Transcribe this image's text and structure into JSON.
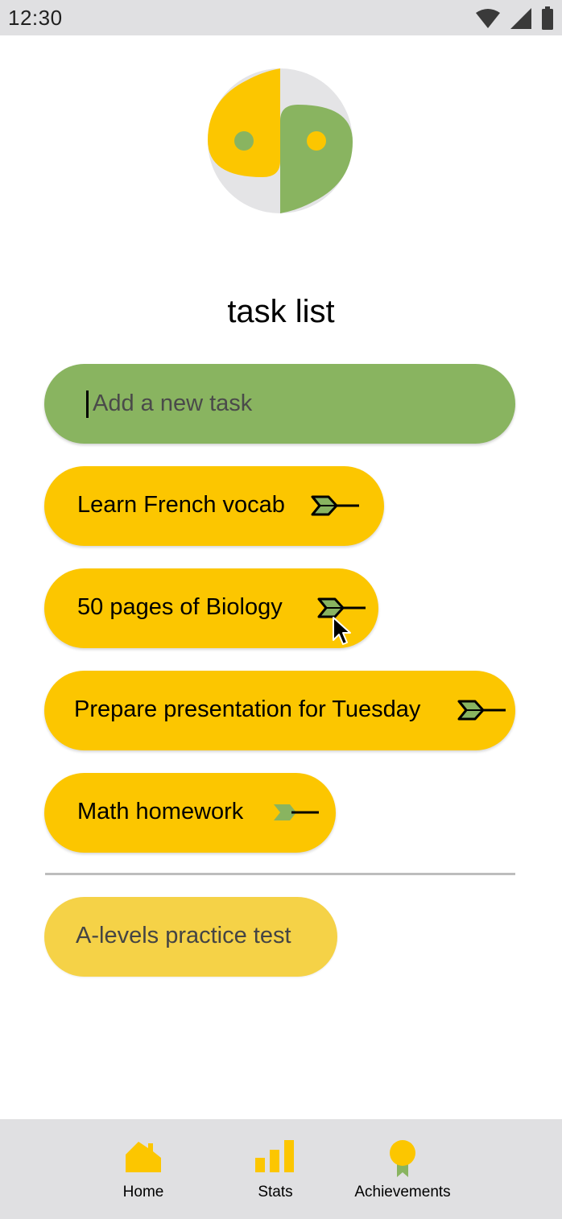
{
  "status_bar": {
    "time": "12:30",
    "icons": [
      "wifi-icon",
      "cellular-signal-icon",
      "battery-icon"
    ]
  },
  "logo": {
    "name": "app-logo",
    "colors": {
      "yellow": "#fcc600",
      "green": "#89b460",
      "gray": "#e4e4e6"
    }
  },
  "title": "task list",
  "new_task_input": {
    "placeholder": "Add a new task",
    "value": ""
  },
  "tasks": [
    {
      "label": "Learn French vocab",
      "icon": "arrow-icon"
    },
    {
      "label": "50 pages of Biology",
      "icon": "arrow-icon"
    },
    {
      "label": "Prepare presentation for Tuesday",
      "icon": "arrow-icon"
    },
    {
      "label": "Math homework",
      "icon": "arrow-icon"
    }
  ],
  "completed_tasks": [
    {
      "label": "A-levels practice test"
    }
  ],
  "bottom_nav": {
    "items": [
      {
        "label": "Home",
        "icon": "home-icon"
      },
      {
        "label": "Stats",
        "icon": "bar-chart-icon"
      },
      {
        "label": "Achievements",
        "icon": "medal-icon"
      }
    ]
  },
  "colors": {
    "accent_yellow": "#fcc600",
    "accent_green": "#89b460",
    "completed_yellow": "#f5d247",
    "bar_gray": "#e0e0e2"
  }
}
